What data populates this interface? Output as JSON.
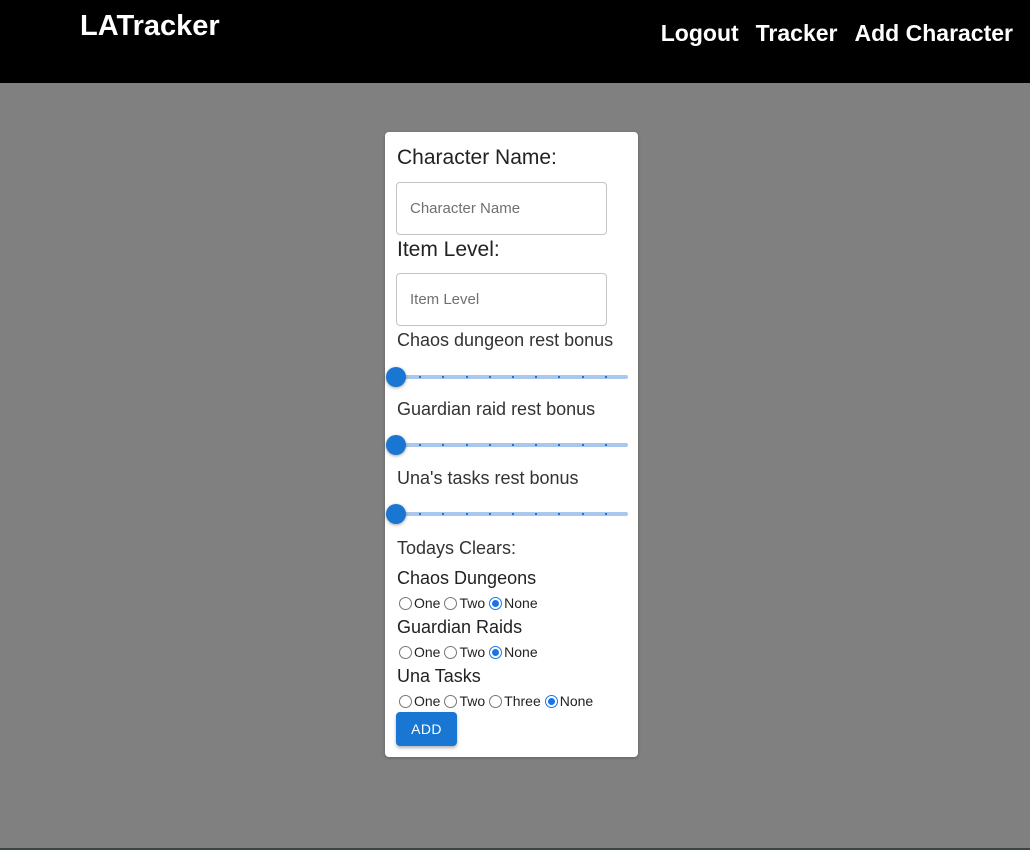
{
  "navbar": {
    "brand": "LATracker",
    "links": [
      {
        "label": "Logout"
      },
      {
        "label": "Tracker"
      },
      {
        "label": "Add Character"
      }
    ]
  },
  "form": {
    "character_name": {
      "label": "Character Name:",
      "placeholder": "Character Name",
      "value": ""
    },
    "item_level": {
      "label": "Item Level:",
      "placeholder": "Item Level",
      "value": ""
    },
    "sliders": [
      {
        "label": "Chaos dungeon rest bonus",
        "value": 0,
        "min": 0,
        "max": 10,
        "step": 1
      },
      {
        "label": "Guardian raid rest bonus",
        "value": 0,
        "min": 0,
        "max": 10,
        "step": 1
      },
      {
        "label": "Una's tasks rest bonus",
        "value": 0,
        "min": 0,
        "max": 10,
        "step": 1
      }
    ],
    "clears_heading": "Todays Clears:",
    "clear_groups": [
      {
        "label": "Chaos Dungeons",
        "options": [
          "One",
          "Two",
          "None"
        ],
        "selected": "None"
      },
      {
        "label": "Guardian Raids",
        "options": [
          "One",
          "Two",
          "None"
        ],
        "selected": "None"
      },
      {
        "label": "Una Tasks",
        "options": [
          "One",
          "Two",
          "Three",
          "None"
        ],
        "selected": "None"
      }
    ],
    "submit_label": "ADD"
  },
  "colors": {
    "accent": "#1976d2",
    "navbar_bg": "#000000",
    "page_bg": "#808080",
    "card_bg": "#ffffff"
  }
}
